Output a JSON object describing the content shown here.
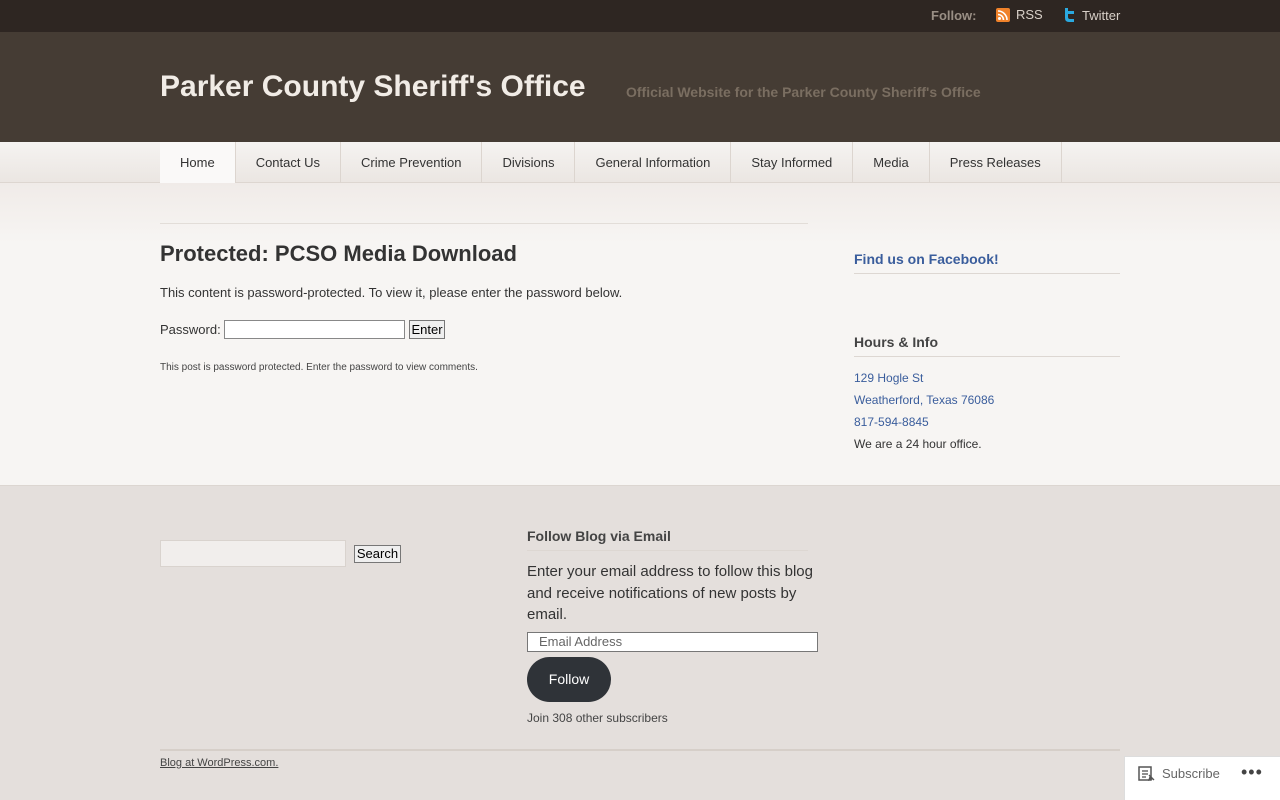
{
  "topbar": {
    "follow_label": "Follow:",
    "rss_label": "RSS",
    "twitter_label": "Twitter"
  },
  "header": {
    "site_title": "Parker County Sheriff's Office",
    "site_description": "Official Website for the Parker County Sheriff's Office"
  },
  "nav": {
    "items": [
      {
        "label": "Home",
        "active": true
      },
      {
        "label": "Contact Us"
      },
      {
        "label": "Crime Prevention"
      },
      {
        "label": "Divisions"
      },
      {
        "label": "General Information"
      },
      {
        "label": "Stay Informed"
      },
      {
        "label": "Media"
      },
      {
        "label": "Press Releases"
      }
    ]
  },
  "post": {
    "title": "Protected: PCSO Media Download",
    "message": "This content is password-protected. To view it, please enter the password below.",
    "password_label": "Password:",
    "password_value": "",
    "enter_button": "Enter",
    "comments_note": "This post is password protected. Enter the password to view comments."
  },
  "sidebar": {
    "facebook_title": "Find us on Facebook!",
    "hours_title": "Hours & Info",
    "address_line1": "129 Hogle St",
    "address_line2": "Weatherford, Texas 76086",
    "phone": "817-594-8845",
    "hours_note": "We are a 24 hour office."
  },
  "footer": {
    "search_value": "",
    "search_button": "Search",
    "follow_title": "Follow Blog via Email",
    "follow_desc": "Enter your email address to follow this blog and receive notifications of new posts by email.",
    "email_placeholder": "Email Address",
    "follow_button": "Follow",
    "subscribers": "Join 308 other subscribers",
    "credit": "Blog at WordPress.com."
  },
  "subscribe_bar": {
    "label": "Subscribe",
    "more": "•••"
  },
  "colors": {
    "topbar_bg": "#2e2622",
    "header_bg": "#453c34",
    "link": "#3a5d9c",
    "rss_orange": "#f0822a",
    "twitter_blue": "#2aa9e0"
  }
}
